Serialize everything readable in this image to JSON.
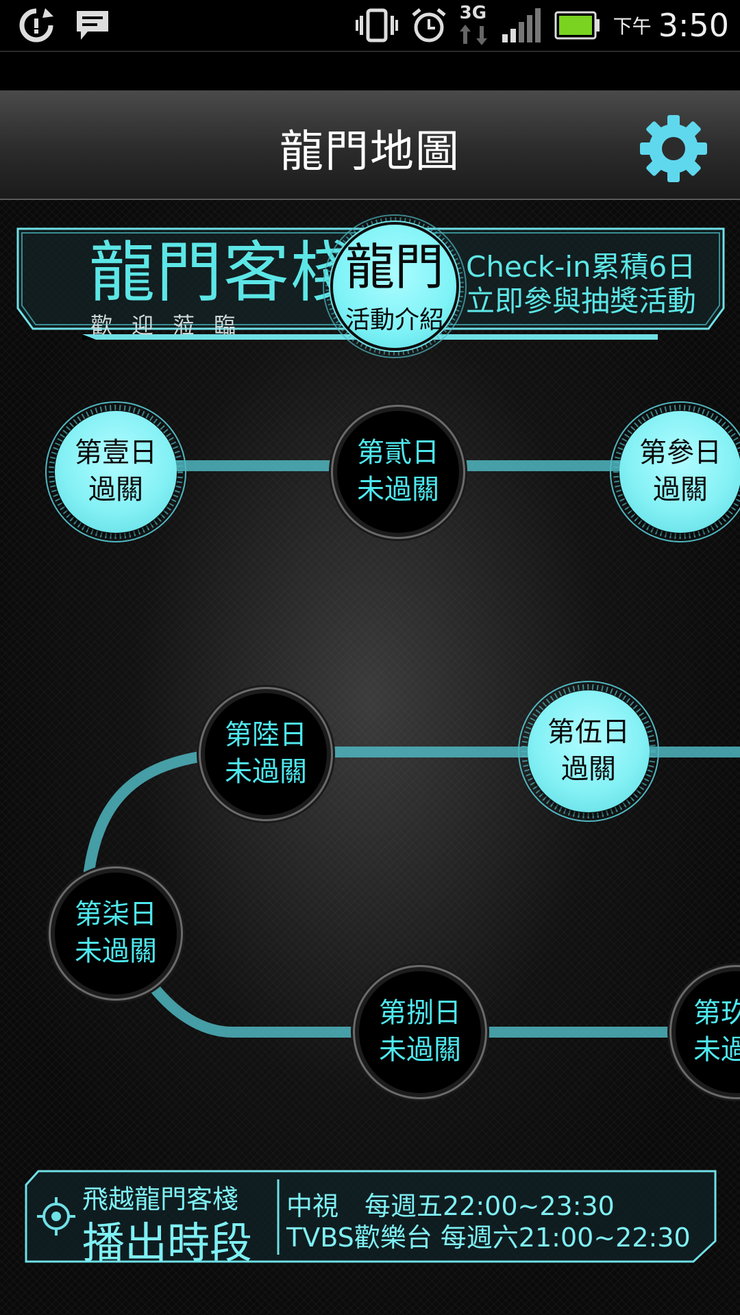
{
  "status_bar": {
    "ampm": "下午",
    "time": "3:50",
    "network": "3G",
    "icons": [
      "sync-icon",
      "message-icon",
      "vibrate-icon",
      "alarm-icon",
      "network-3g-icon",
      "signal-icon",
      "battery-icon"
    ]
  },
  "header": {
    "title": "龍門地圖",
    "settings_icon": "gear-icon"
  },
  "banner": {
    "logo_main": "龍門客棧",
    "logo_sub": "歡迎蒞臨",
    "badge_title": "龍門",
    "badge_sub": "活動介紹",
    "info_line1": "Check-in累積6日",
    "info_line2": "立即參與抽獎活動"
  },
  "days": [
    {
      "day": "第壹日",
      "status": "過關",
      "passed": true
    },
    {
      "day": "第貳日",
      "status": "未過關",
      "passed": false
    },
    {
      "day": "第參日",
      "status": "過關",
      "passed": true
    },
    {
      "day": "第伍日",
      "status": "過關",
      "passed": true
    },
    {
      "day": "第陸日",
      "status": "未過關",
      "passed": false
    },
    {
      "day": "第柒日",
      "status": "未過關",
      "passed": false
    },
    {
      "day": "第捌日",
      "status": "未過關",
      "passed": false
    },
    {
      "day": "第玖日",
      "status": "未過關",
      "passed": false
    }
  ],
  "broadcast": {
    "title_small": "飛越龍門客棧",
    "title_big": "播出時段",
    "line1": "中視　每週五22:00~23:30",
    "line2": "TVBS歡樂台 每週六21:00~22:30",
    "icon": "crosshair-icon"
  },
  "colors": {
    "accent": "#5de6e6",
    "node_passed": "#84f1f5",
    "background": "#000000"
  }
}
